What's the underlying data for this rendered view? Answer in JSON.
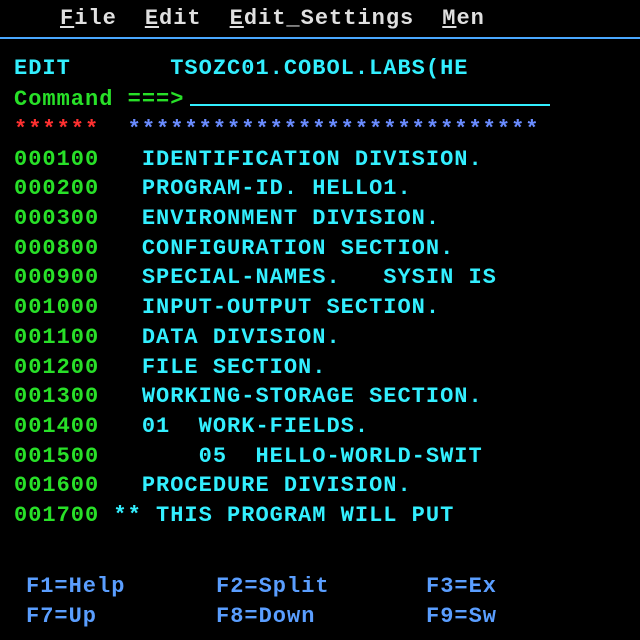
{
  "menu": {
    "file": "File",
    "edit": "Edit",
    "edit_settings": "Edit_Settings",
    "menu_more": "Men"
  },
  "header": {
    "mode": "EDIT",
    "dataset": "TSOZC01.COBOL.LABS(HE"
  },
  "command": {
    "label": "Command ===>"
  },
  "top_marker": {
    "stars": "******",
    "banner": "*****************************"
  },
  "lines": [
    {
      "num": "000100",
      "text": "IDENTIFICATION DIVISION."
    },
    {
      "num": "000200",
      "text": "PROGRAM-ID. HELLO1."
    },
    {
      "num": "000300",
      "text": "ENVIRONMENT DIVISION."
    },
    {
      "num": "000800",
      "text": "CONFIGURATION SECTION."
    },
    {
      "num": "000900",
      "text": "SPECIAL-NAMES.   SYSIN IS"
    },
    {
      "num": "001000",
      "text": "INPUT-OUTPUT SECTION."
    },
    {
      "num": "001100",
      "text": "DATA DIVISION."
    },
    {
      "num": "001200",
      "text": "FILE SECTION."
    },
    {
      "num": "001300",
      "text": "WORKING-STORAGE SECTION."
    },
    {
      "num": "001400",
      "text": "01  WORK-FIELDS."
    },
    {
      "num": "001500",
      "text": "    05  HELLO-WORLD-SWIT"
    },
    {
      "num": "001600",
      "text": "PROCEDURE DIVISION."
    }
  ],
  "comment_line": {
    "num": "001700",
    "marker": "**",
    "text": "THIS PROGRAM WILL PUT "
  },
  "fkeys": {
    "row1": {
      "f1": "F1=Help",
      "f2": "F2=Split",
      "f3": "F3=Ex"
    },
    "row2": {
      "f7": "F7=Up",
      "f8": "F8=Down",
      "f9": "F9=Sw"
    }
  }
}
